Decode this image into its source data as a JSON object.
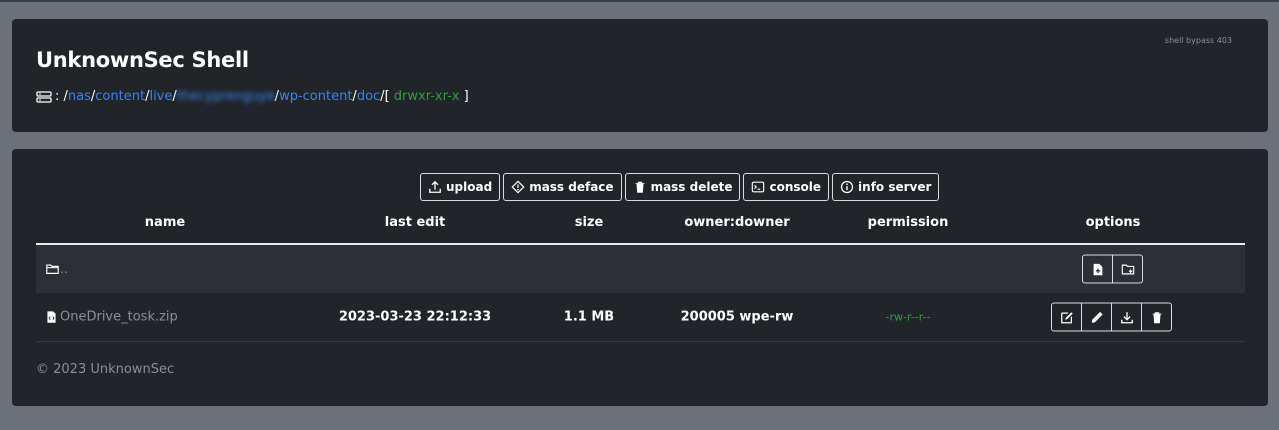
{
  "header": {
    "title": "UnknownSec Shell",
    "bypass_label": "shell bypass 403",
    "path_prefix": ": /",
    "path_segments": [
      "nas",
      "content",
      "live",
      "thecyprenguye",
      "wp-content",
      "doc"
    ],
    "permission_open": "[ ",
    "permission": "drwxr-xr-x",
    "permission_close": " ]"
  },
  "toolbar": {
    "upload": "upload",
    "mass_deface": "mass deface",
    "mass_delete": "mass delete",
    "console": "console",
    "info_server": "info server"
  },
  "table": {
    "columns": {
      "name": "name",
      "last_edit": "last edit",
      "size": "size",
      "owner": "owner:downer",
      "permission": "permission",
      "options": "options"
    },
    "parent_row": {
      "name": ".."
    },
    "file_row": {
      "name": "OneDrive_tosk.zip",
      "last_edit": "2023-03-23 22:12:33",
      "size": "1.1 MB",
      "owner": "200005 wpe-rw",
      "permission": "-rw-r--r--"
    }
  },
  "footer": {
    "text": "© 2023 UnknownSec"
  },
  "colors": {
    "page_bg": "#6c7079",
    "card_bg": "#212529",
    "link": "#3b82f6",
    "perm_green": "#2ea043"
  },
  "icons": [
    "server-icon",
    "upload-icon",
    "deface-icon",
    "trash-icon",
    "terminal-icon",
    "info-icon",
    "folder-icon",
    "file-plus-icon",
    "folder-plus-icon",
    "zip-file-icon",
    "edit-icon",
    "rename-pencil-icon",
    "download-icon"
  ]
}
